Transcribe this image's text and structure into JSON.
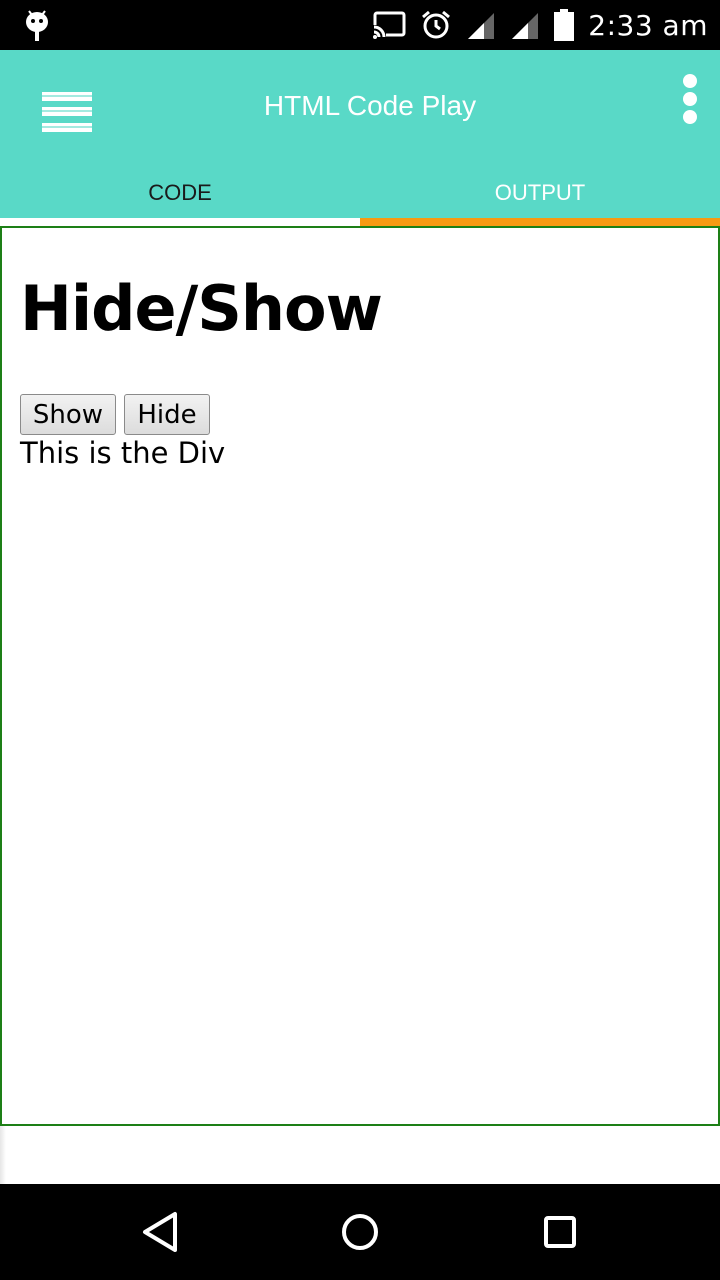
{
  "status_bar": {
    "time": "2:33 am",
    "icons": [
      "android-debug-icon",
      "cast-icon",
      "alarm-icon",
      "signal-icon",
      "signal-icon-2",
      "battery-icon"
    ]
  },
  "app_bar": {
    "title": "HTML Code Play",
    "background_color": "#59d9c7",
    "tabs": [
      {
        "label": "CODE",
        "selected": false
      },
      {
        "label": "OUTPUT",
        "selected": true
      }
    ],
    "tab_indicator_color": "#f79a12"
  },
  "output": {
    "heading": "Hide/Show",
    "buttons": [
      {
        "label": "Show"
      },
      {
        "label": "Hide"
      }
    ],
    "div_text": "This is the Div",
    "frame_border_color": "#1d7f16"
  },
  "nav_bar": {
    "icons": [
      "back-icon",
      "home-icon",
      "recents-icon"
    ]
  }
}
